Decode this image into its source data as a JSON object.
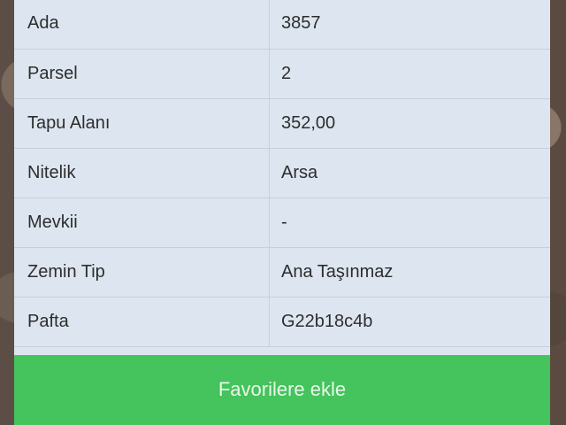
{
  "property_details": {
    "rows": [
      {
        "label": "Ada",
        "value": "3857"
      },
      {
        "label": "Parsel",
        "value": "2"
      },
      {
        "label": "Tapu Alanı",
        "value": "352,00"
      },
      {
        "label": "Nitelik",
        "value": "Arsa"
      },
      {
        "label": "Mevkii",
        "value": "-"
      },
      {
        "label": "Zemin Tip",
        "value": "Ana Taşınmaz"
      },
      {
        "label": "Pafta",
        "value": "G22b18c4b"
      }
    ]
  },
  "actions": {
    "favorite_label": "Favorilere ekle"
  },
  "colors": {
    "panel_background": "#dde6f0",
    "button_green": "#45c35c"
  }
}
